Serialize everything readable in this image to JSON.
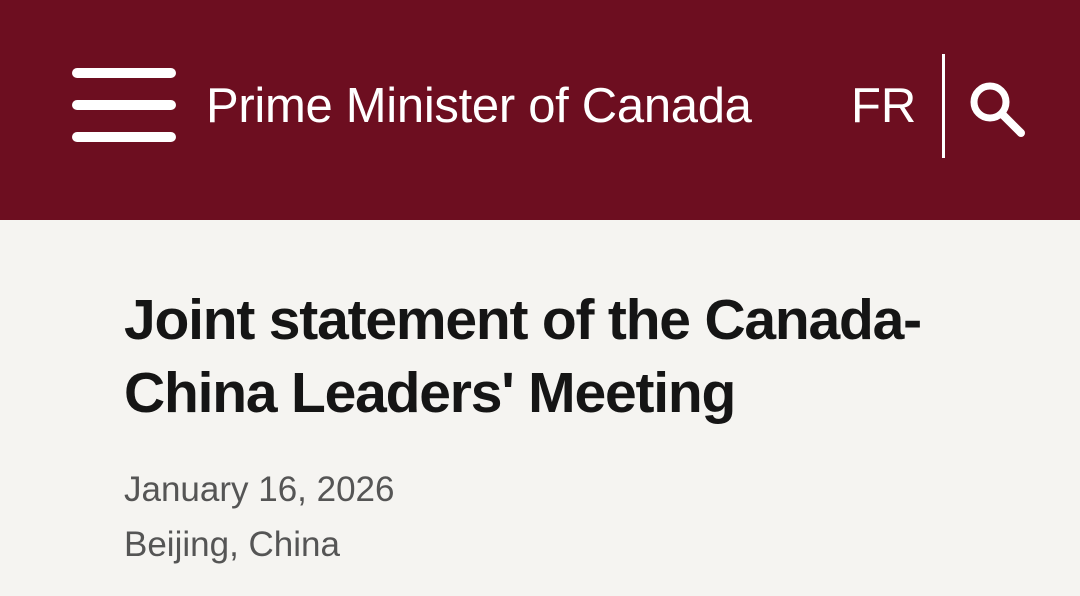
{
  "header": {
    "site_title": "Prime Minister of Canada",
    "language_toggle": "FR",
    "background_color": "#6d0e20",
    "icons": {
      "menu": "hamburger-menu-icon",
      "search": "search-icon"
    }
  },
  "article": {
    "title": "Joint statement of the Canada-China Leaders' Meeting",
    "date": "January 16, 2026",
    "location": "Beijing, China"
  }
}
